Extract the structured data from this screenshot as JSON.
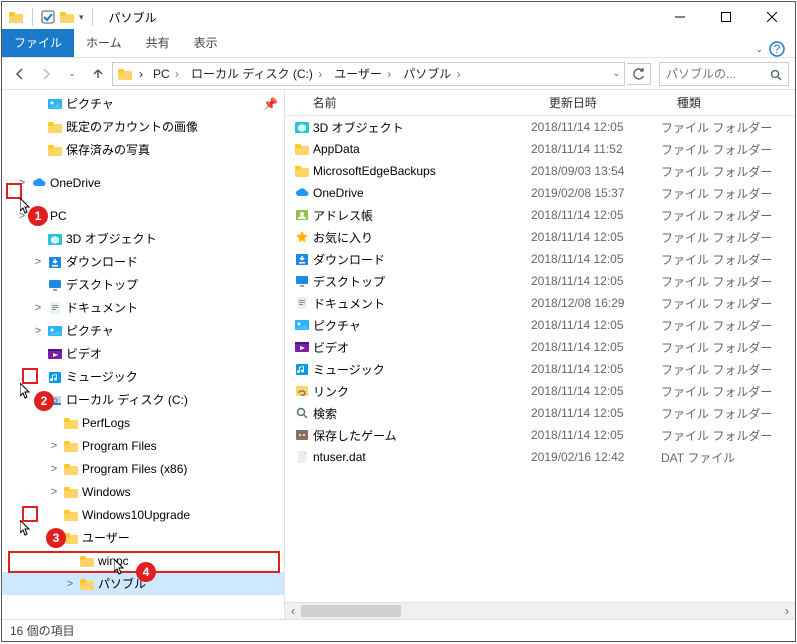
{
  "window": {
    "title": "パソブル"
  },
  "ribbon": {
    "file": "ファイル",
    "tabs": [
      "ホーム",
      "共有",
      "表示"
    ]
  },
  "breadcrumbs": [
    "PC",
    "ローカル ディスク (C:)",
    "ユーザー",
    "パソブル"
  ],
  "search": {
    "placeholder": "パソブルの..."
  },
  "columns": {
    "name": "名前",
    "date": "更新日時",
    "type": "種類"
  },
  "nav": {
    "quick": [
      {
        "label": "ピクチャ",
        "icon": "pictures",
        "indent": 28,
        "pin": true
      },
      {
        "label": "既定のアカウントの画像",
        "icon": "folder",
        "indent": 28
      },
      {
        "label": "保存済みの写真",
        "icon": "folder",
        "indent": 28
      }
    ],
    "onedrive": {
      "label": "OneDrive",
      "icon": "cloud",
      "indent": 12,
      "expander": ">"
    },
    "pc": {
      "label": "PC",
      "icon": "pc",
      "indent": 12,
      "expander": ">"
    },
    "pc_children": [
      {
        "label": "3D オブジェクト",
        "icon": "3d",
        "indent": 28
      },
      {
        "label": "ダウンロード",
        "icon": "download",
        "indent": 28,
        "expander": ">"
      },
      {
        "label": "デスクトップ",
        "icon": "desktop",
        "indent": 28
      },
      {
        "label": "ドキュメント",
        "icon": "document",
        "indent": 28,
        "expander": ">"
      },
      {
        "label": "ピクチャ",
        "icon": "pictures",
        "indent": 28,
        "expander": ">"
      },
      {
        "label": "ビデオ",
        "icon": "video",
        "indent": 28
      },
      {
        "label": "ミュージック",
        "icon": "music",
        "indent": 28
      }
    ],
    "disk": {
      "label": "ローカル ディスク (C:)",
      "icon": "disk",
      "indent": 28,
      "expander": ">"
    },
    "disk_children": [
      {
        "label": "PerfLogs",
        "icon": "folder",
        "indent": 44
      },
      {
        "label": "Program Files",
        "icon": "folder",
        "indent": 44,
        "expander": ">"
      },
      {
        "label": "Program Files (x86)",
        "icon": "folder",
        "indent": 44,
        "expander": ">"
      },
      {
        "label": "Windows",
        "icon": "folder",
        "indent": 44,
        "expander": ">"
      },
      {
        "label": "Windows10Upgrade",
        "icon": "folder",
        "indent": 44
      }
    ],
    "users": {
      "label": "ユーザー",
      "icon": "folder",
      "indent": 44,
      "expander": ">"
    },
    "users_children": [
      {
        "label": "winpc",
        "icon": "folder",
        "indent": 60,
        "partial": true
      },
      {
        "label": "パソブル",
        "icon": "folder",
        "indent": 60,
        "expander": ">",
        "selected": true
      }
    ]
  },
  "items": [
    {
      "name": "3D オブジェクト",
      "icon": "3d",
      "date": "2018/11/14 12:05",
      "type": "ファイル フォルダー"
    },
    {
      "name": "AppData",
      "icon": "folder",
      "date": "2018/11/14 11:52",
      "type": "ファイル フォルダー"
    },
    {
      "name": "MicrosoftEdgeBackups",
      "icon": "folder",
      "date": "2018/09/03 13:54",
      "type": "ファイル フォルダー"
    },
    {
      "name": "OneDrive",
      "icon": "cloud",
      "date": "2019/02/08 15:37",
      "type": "ファイル フォルダー"
    },
    {
      "name": "アドレス帳",
      "icon": "contacts",
      "date": "2018/11/14 12:05",
      "type": "ファイル フォルダー"
    },
    {
      "name": "お気に入り",
      "icon": "star",
      "date": "2018/11/14 12:05",
      "type": "ファイル フォルダー"
    },
    {
      "name": "ダウンロード",
      "icon": "download",
      "date": "2018/11/14 12:05",
      "type": "ファイル フォルダー"
    },
    {
      "name": "デスクトップ",
      "icon": "desktop",
      "date": "2018/11/14 12:05",
      "type": "ファイル フォルダー"
    },
    {
      "name": "ドキュメント",
      "icon": "document",
      "date": "2018/12/08 16:29",
      "type": "ファイル フォルダー"
    },
    {
      "name": "ピクチャ",
      "icon": "pictures",
      "date": "2018/11/14 12:05",
      "type": "ファイル フォルダー"
    },
    {
      "name": "ビデオ",
      "icon": "video",
      "date": "2018/11/14 12:05",
      "type": "ファイル フォルダー"
    },
    {
      "name": "ミュージック",
      "icon": "music",
      "date": "2018/11/14 12:05",
      "type": "ファイル フォルダー"
    },
    {
      "name": "リンク",
      "icon": "link",
      "date": "2018/11/14 12:05",
      "type": "ファイル フォルダー"
    },
    {
      "name": "検索",
      "icon": "search",
      "date": "2018/11/14 12:05",
      "type": "ファイル フォルダー"
    },
    {
      "name": "保存したゲーム",
      "icon": "games",
      "date": "2018/11/14 12:05",
      "type": "ファイル フォルダー"
    },
    {
      "name": "ntuser.dat",
      "icon": "file",
      "date": "2019/02/16 12:42",
      "type": "DAT ファイル"
    }
  ],
  "status": "16 個の項目",
  "annotations": {
    "c1": "1",
    "c2": "2",
    "c3": "3",
    "c4": "4"
  },
  "colors": {
    "accent": "#1979ca",
    "selection": "#cde8ff",
    "callout": "#e02020"
  }
}
